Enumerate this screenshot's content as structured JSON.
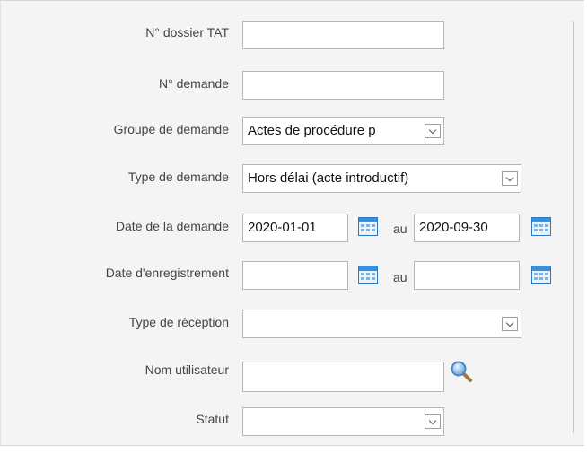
{
  "form": {
    "dossier_label": "N° dossier TAT",
    "dossier_value": "",
    "demande_label": "N° demande",
    "demande_value": "",
    "groupe_label": "Groupe de demande",
    "groupe_value": "Actes de procédure p",
    "type_label": "Type de demande",
    "type_value": "Hors délai (acte introductif)",
    "date_demande_label": "Date de la demande",
    "date_demande_from": "2020-01-01",
    "date_demande_to": "2020-09-30",
    "au": "au",
    "date_enreg_label": "Date d'enregistrement",
    "date_enreg_from": "",
    "date_enreg_to": "",
    "reception_label": "Type de réception",
    "reception_value": "",
    "utilisateur_label": "Nom utilisateur",
    "utilisateur_value": "",
    "statut_label": "Statut",
    "statut_value": ""
  },
  "icons": {
    "calendar": "calendar-icon",
    "search": "search-icon",
    "dropdown": "chevron-down-icon"
  },
  "colors": {
    "panel_bg": "#f4f4f4",
    "calendar_blue": "#3b8fd6"
  }
}
